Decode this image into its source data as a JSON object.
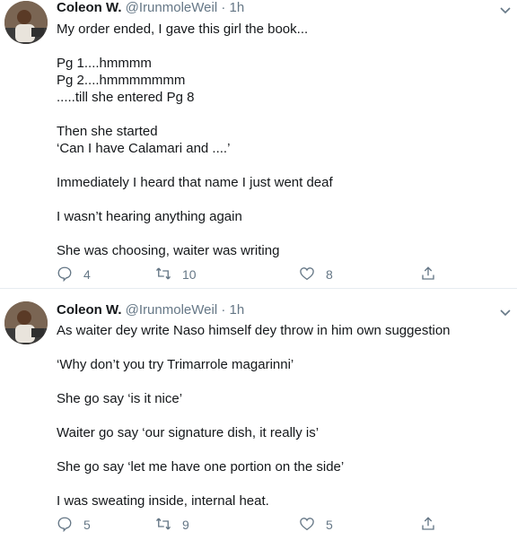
{
  "tweets": [
    {
      "author_name": "Coleon W.",
      "handle": "@IrunmoleWeil",
      "separator": "·",
      "time": "1h",
      "lines": [
        "My order ended, I gave this girl the book...",
        "",
        "Pg 1....hmmmm",
        "Pg 2....hmmmmmmm",
        ".....till she entered Pg 8",
        "",
        "Then she started",
        "‘Can I have Calamari and ....’",
        "",
        "Immediately I heard that name I just went deaf",
        "",
        "I wasn’t hearing anything again",
        "",
        "She was choosing, waiter was writing"
      ],
      "reply_count": "4",
      "retweet_count": "10",
      "like_count": "8"
    },
    {
      "author_name": "Coleon W.",
      "handle": "@IrunmoleWeil",
      "separator": "·",
      "time": "1h",
      "lines": [
        "As waiter dey write Naso himself dey throw in him own suggestion",
        "",
        "‘Why don’t you try Trimarrole magarinni’",
        "",
        "She go say ‘is it nice’",
        "",
        "Waiter go say ‘our signature dish, it really is’",
        "",
        "She go say ‘let me have one portion on the side’",
        "",
        "I was sweating inside, internal heat."
      ],
      "reply_count": "5",
      "retweet_count": "9",
      "like_count": "5"
    }
  ],
  "icons": {
    "reply": "reply-icon",
    "retweet": "retweet-icon",
    "like": "heart-icon",
    "share": "share-icon",
    "caret": "chevron-down-icon"
  },
  "colors": {
    "text": "#14171a",
    "secondary": "#657786",
    "divider": "#e6ecf0"
  }
}
